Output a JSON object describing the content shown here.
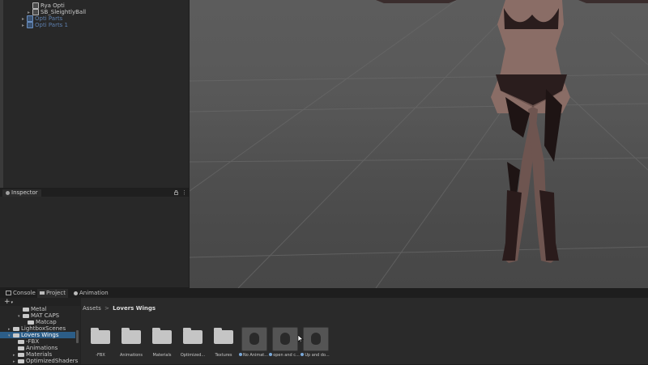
{
  "hierarchy": {
    "items": [
      {
        "label": "Rya Opti",
        "indent": 2,
        "dim": false,
        "arrow": ""
      },
      {
        "label": "SB_SleightlyBall",
        "indent": 2,
        "dim": false,
        "arrow": "▸"
      },
      {
        "label": "Opti Parts",
        "indent": 1,
        "dim": true,
        "arrow": "▸"
      },
      {
        "label": "Opti Parts 1",
        "indent": 1,
        "dim": true,
        "arrow": "▸"
      }
    ]
  },
  "inspector": {
    "tab_label": "Inspector",
    "lock_icon": "lock-icon",
    "menu_icon": "kebab-menu-icon"
  },
  "bottom": {
    "tabs": [
      {
        "label": "Console",
        "icon": "console-icon"
      },
      {
        "label": "Project",
        "icon": "folder-icon"
      },
      {
        "label": "Animation",
        "icon": "animation-icon"
      }
    ],
    "add_button": "+",
    "tree": [
      {
        "label": "Metal",
        "indent": 3,
        "sel": false,
        "arrow": ""
      },
      {
        "label": "MAT CAPS",
        "indent": 3,
        "sel": false,
        "arrow": "▾"
      },
      {
        "label": "Matcap",
        "indent": 4,
        "sel": false,
        "arrow": ""
      },
      {
        "label": "LightboxScenes",
        "indent": 1,
        "sel": false,
        "arrow": "▸"
      },
      {
        "label": "Lovers Wings",
        "indent": 1,
        "sel": true,
        "arrow": "▾"
      },
      {
        "label": "-FBX",
        "indent": 2,
        "sel": false,
        "arrow": ""
      },
      {
        "label": "Animations",
        "indent": 2,
        "sel": false,
        "arrow": ""
      },
      {
        "label": "Materials",
        "indent": 2,
        "sel": false,
        "arrow": "▸"
      },
      {
        "label": "OptimizedShaders",
        "indent": 2,
        "sel": false,
        "arrow": "▸"
      }
    ],
    "breadcrumb": {
      "root": "Assets",
      "sep": ">",
      "current": "Lovers Wings"
    },
    "assets": [
      {
        "label": "-FBX",
        "kind": "folder"
      },
      {
        "label": "Animations",
        "kind": "folder"
      },
      {
        "label": "Materials",
        "kind": "folder"
      },
      {
        "label": "Optimized...",
        "kind": "folder"
      },
      {
        "label": "Textures",
        "kind": "folder"
      },
      {
        "label": "No Animat...",
        "kind": "anim"
      },
      {
        "label": "open and c...",
        "kind": "anim"
      },
      {
        "label": "Up and do...",
        "kind": "anim"
      }
    ]
  },
  "colors": {
    "selection": "#2c5d87",
    "panel": "#282828",
    "prefab_text": "#5d7fae"
  }
}
